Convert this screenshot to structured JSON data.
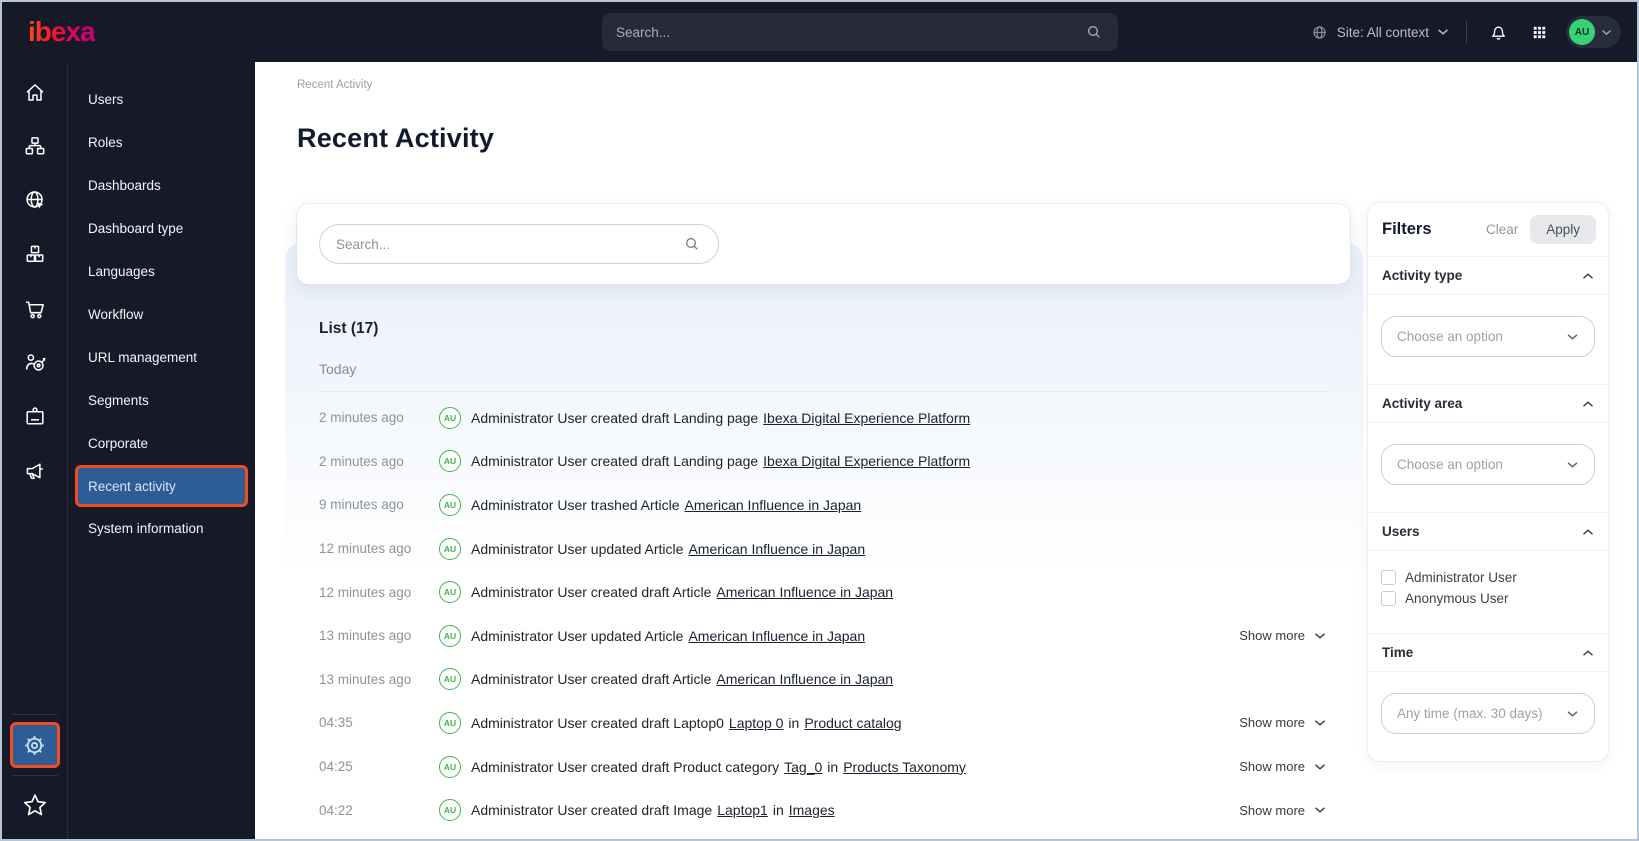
{
  "topbar": {
    "logo_text": "ibexa",
    "search_placeholder": "Search...",
    "site_context_label": "Site: All context",
    "avatar_initials": "AU"
  },
  "sidebar_rail": {
    "items": [
      "home",
      "content-tree",
      "site",
      "product-catalog",
      "commerce",
      "personalization",
      "corporate",
      "campaign"
    ],
    "bottom_items": [
      "settings",
      "bookmarks"
    ],
    "active": "settings"
  },
  "sidebar": {
    "items": [
      "Users",
      "Roles",
      "Dashboards",
      "Dashboard type",
      "Languages",
      "Workflow",
      "URL management",
      "Segments",
      "Corporate",
      "Recent activity",
      "System information"
    ],
    "active_index": 9
  },
  "breadcrumb": "Recent Activity",
  "page": {
    "title": "Recent Activity",
    "search_placeholder": "Search...",
    "list_title": "List (17)",
    "group_label": "Today",
    "show_more_label": "Show more",
    "avatar_initials": "AU"
  },
  "activities": [
    {
      "time": "2 minutes ago",
      "text": "Administrator User created draft Landing page",
      "link": "Ibexa Digital Experience Platform",
      "show_more": false
    },
    {
      "time": "2 minutes ago",
      "text": "Administrator User created draft Landing page",
      "link": "Ibexa Digital Experience Platform",
      "show_more": false
    },
    {
      "time": "9 minutes ago",
      "text": "Administrator User trashed Article",
      "link": "American Influence in Japan",
      "show_more": false
    },
    {
      "time": "12 minutes ago",
      "text": "Administrator User updated Article",
      "link": "American Influence in Japan",
      "show_more": false
    },
    {
      "time": "12 minutes ago",
      "text": "Administrator User created draft Article",
      "link": "American Influence in Japan",
      "show_more": false
    },
    {
      "time": "13 minutes ago",
      "text": "Administrator User updated Article",
      "link": "American Influence in Japan",
      "show_more": true
    },
    {
      "time": "13 minutes ago",
      "text": "Administrator User created draft Article",
      "link": "American Influence in Japan",
      "show_more": false
    },
    {
      "time": "04:35",
      "text": "Administrator User created draft Laptop0",
      "link": "Laptop 0",
      "mid": "in",
      "link2": "Product catalog",
      "show_more": true
    },
    {
      "time": "04:25",
      "text": "Administrator User created draft Product category",
      "link": "Tag_0",
      "mid": "in",
      "link2": "Products Taxonomy",
      "show_more": true
    },
    {
      "time": "04:22",
      "text": "Administrator User created draft Image",
      "link": "Laptop1",
      "mid": "in",
      "link2": "Images",
      "show_more": true
    }
  ],
  "filters": {
    "title": "Filters",
    "clear_label": "Clear",
    "apply_label": "Apply",
    "sections": [
      {
        "label": "Activity type",
        "control": "select",
        "placeholder": "Choose an option"
      },
      {
        "label": "Activity area",
        "control": "select",
        "placeholder": "Choose an option"
      },
      {
        "label": "Users",
        "control": "checkboxes",
        "options": [
          "Administrator User",
          "Anonymous User"
        ],
        "checked": [
          false,
          false
        ]
      },
      {
        "label": "Time",
        "control": "select",
        "placeholder": "Any time (max. 30 days)"
      }
    ]
  },
  "icons": {
    "topbar": [
      "globe-icon",
      "chevron-down-icon",
      "bell-icon",
      "app-grid-icon",
      "search-icon"
    ],
    "rail": [
      "home-icon",
      "content-tree-icon",
      "site-globe-icon",
      "boxes-icon",
      "cart-icon",
      "person-target-icon",
      "badge-icon",
      "megaphone-icon",
      "gear-icon",
      "star-icon"
    ],
    "misc": [
      "magnifier-icon",
      "chevron-up-icon",
      "checkbox"
    ]
  },
  "colors": {
    "topbar_bg": "#161a28",
    "accent_orange": "#f04e1f",
    "active_blue": "#2d5c96",
    "avatar_green_ring": "#3cb54a",
    "avatar_green_solid": "#38d173",
    "logo_gradient": [
      "#ff4713",
      "#d6006c"
    ]
  }
}
